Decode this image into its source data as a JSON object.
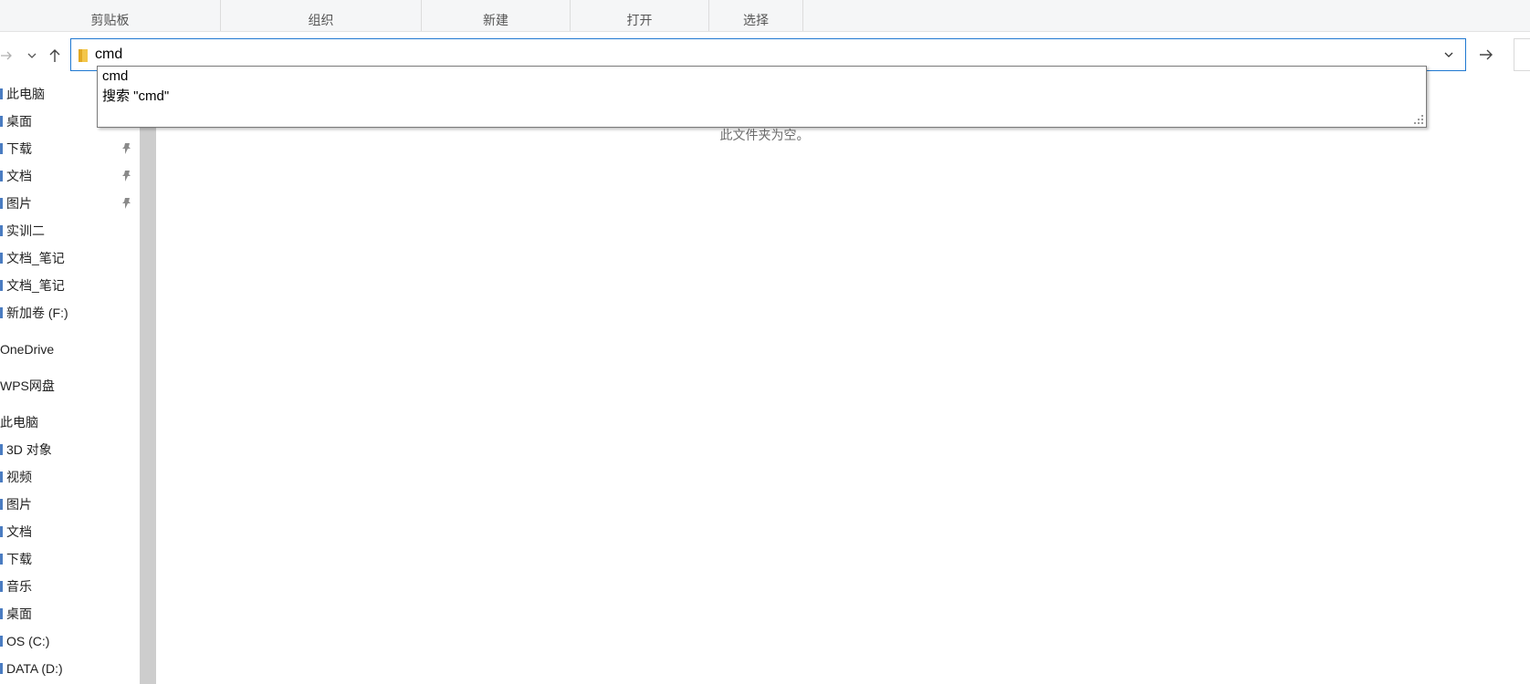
{
  "ribbon": {
    "groups": [
      "剪贴板",
      "组织",
      "新建",
      "打开",
      "选择"
    ]
  },
  "address": {
    "value": "cmd",
    "icon": "folder-icon"
  },
  "suggestions": [
    "cmd",
    "搜索 \"cmd\""
  ],
  "sidebar": {
    "items": [
      {
        "label": "此电脑"
      },
      {
        "label": "桌面"
      },
      {
        "label": "下载",
        "pinned": true
      },
      {
        "label": "文档",
        "pinned": true
      },
      {
        "label": "图片",
        "pinned": true
      },
      {
        "label": "实训二"
      },
      {
        "label": "文档_笔记"
      },
      {
        "label": "文档_笔记"
      },
      {
        "label": "新加卷 (F:)"
      },
      {
        "label": "OneDrive"
      },
      {
        "label": "WPS网盘"
      },
      {
        "label": "此电脑"
      },
      {
        "label": "3D 对象"
      },
      {
        "label": "视频"
      },
      {
        "label": "图片"
      },
      {
        "label": "文档"
      },
      {
        "label": "下载"
      },
      {
        "label": "音乐"
      },
      {
        "label": "桌面"
      },
      {
        "label": "OS (C:)"
      },
      {
        "label": "DATA (D:)"
      }
    ]
  },
  "content": {
    "empty_message": "此文件夹为空。"
  },
  "colors": {
    "accent": "#1f78d1",
    "scrollbar": "#cdcdcd"
  }
}
